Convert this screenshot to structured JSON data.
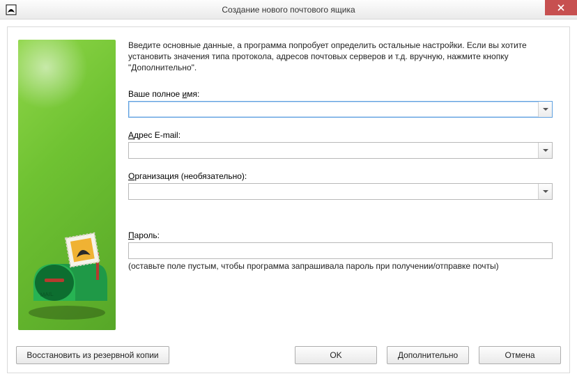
{
  "window": {
    "title": "Создание нового почтового ящика"
  },
  "intro": "Введите основные данные, а программа попробует определить остальные настройки. Если вы хотите установить значения типа протокола, адресов почтовых серверов и т.д. вручную, нажмите кнопку \"Дополнительно\".",
  "fields": {
    "name": {
      "label_pre": "Ваше полное ",
      "label_ul": "и",
      "label_post": "мя:",
      "value": ""
    },
    "email": {
      "label_ul": "А",
      "label_post": "дрес E-mail:",
      "value": ""
    },
    "org": {
      "label_ul": "О",
      "label_post": "рганизация (необязательно):",
      "value": ""
    },
    "password": {
      "label_ul": "П",
      "label_post": "ароль:",
      "value": "",
      "hint": "(оставьте поле пустым, чтобы программа запрашивала пароль при получении/отправке почты)"
    }
  },
  "buttons": {
    "restore": "Восстановить из резервной копии",
    "ok": "OK",
    "advanced": "Дополнительно",
    "cancel": "Отмена"
  }
}
